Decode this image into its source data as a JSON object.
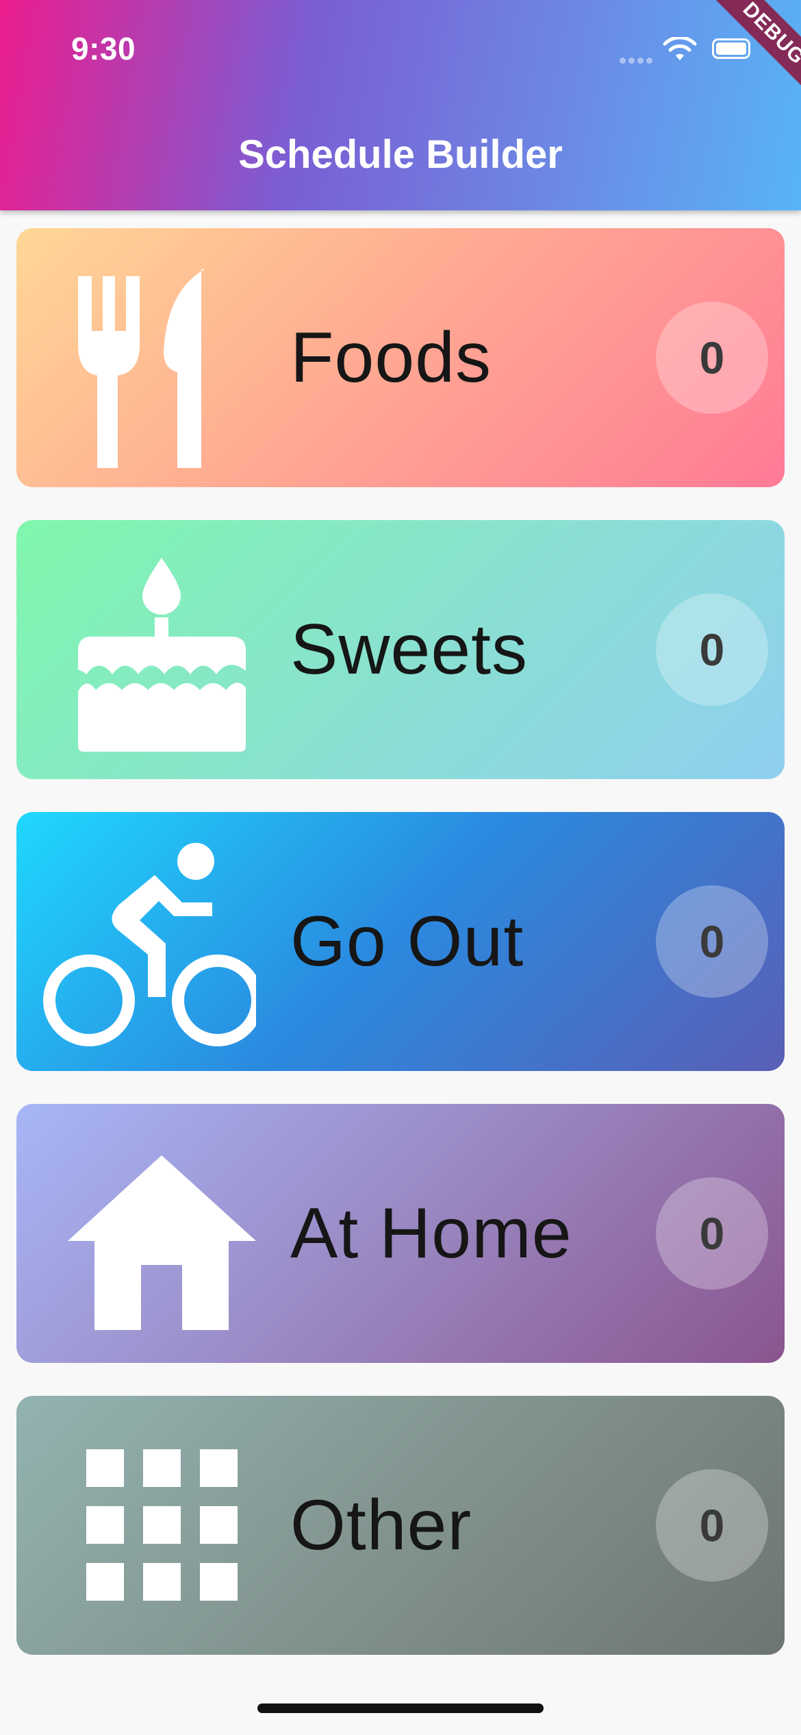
{
  "status_bar": {
    "time": "9:30"
  },
  "app_bar": {
    "title": "Schedule Builder",
    "debug_label": "DEBUG"
  },
  "categories": [
    {
      "label": "Foods",
      "count": "0",
      "icon": "restaurant-icon"
    },
    {
      "label": "Sweets",
      "count": "0",
      "icon": "cake-icon"
    },
    {
      "label": "Go Out",
      "count": "0",
      "icon": "bicycle-icon"
    },
    {
      "label": "At Home",
      "count": "0",
      "icon": "home-icon"
    },
    {
      "label": "Other",
      "count": "0",
      "icon": "apps-grid-icon"
    }
  ],
  "colors": {
    "header_gradient": [
      "#ec1d8e",
      "#7a5ed4",
      "#58b4f6"
    ],
    "foods": [
      "#ffd796",
      "#ff7a96"
    ],
    "sweets": [
      "#80f7ad",
      "#8fcff0"
    ],
    "go_out": [
      "#1fd8ff",
      "#5a5eb5"
    ],
    "at_home": [
      "#a7b6f7",
      "#8a558f"
    ],
    "other": [
      "#93b3b0",
      "#6d7572"
    ]
  }
}
